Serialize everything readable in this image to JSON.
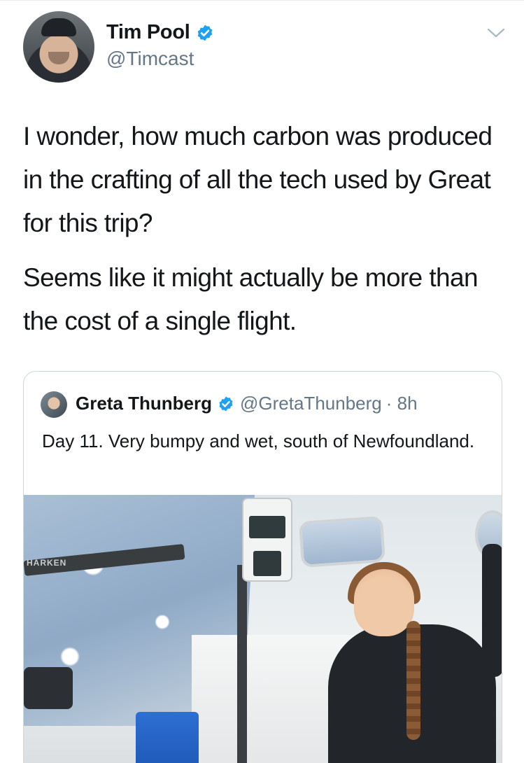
{
  "author": {
    "display_name": "Tim Pool",
    "handle": "@Timcast",
    "verified": true
  },
  "tweet": {
    "paragraph_1": "I wonder, how much carbon was produced in the crafting of all the tech used by Great for this trip?",
    "paragraph_2": "Seems like it might actually be more than the cost of a single flight."
  },
  "quoted_tweet": {
    "display_name": "Greta Thunberg",
    "handle": "@GretaThunberg",
    "time": "· 8h",
    "text": "Day 11. Very bumpy and wet, south of Newfoundland.",
    "verified": true,
    "media_label": "HARKEN"
  },
  "icons": {
    "verified": "verified-badge-icon",
    "menu": "chevron-down-icon"
  },
  "colors": {
    "verified_blue": "#1da1f2",
    "secondary_text": "#657786",
    "border": "#ccd6dd"
  }
}
